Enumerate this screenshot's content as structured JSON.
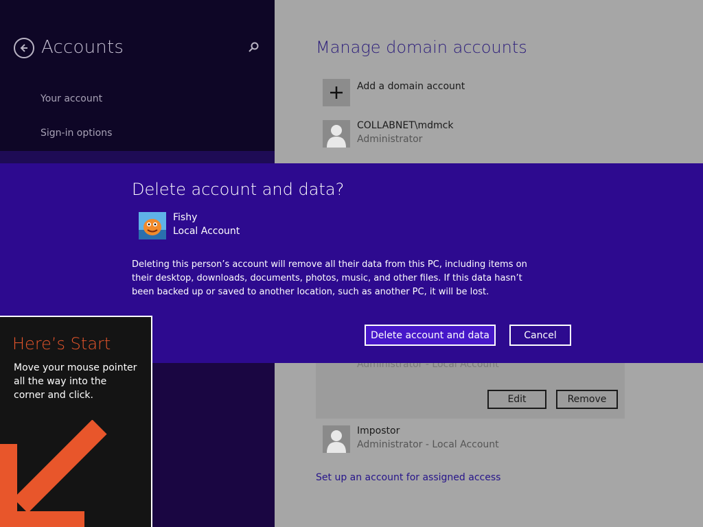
{
  "settings": {
    "title": "Accounts",
    "nav": [
      {
        "label": "Your account"
      },
      {
        "label": "Sign-in options"
      }
    ]
  },
  "content": {
    "heading": "Manage domain accounts",
    "add_label": "Add a domain account",
    "accounts": [
      {
        "name": "COLLABNET\\mdmck",
        "role": "Administrator"
      }
    ],
    "selected_card": {
      "role": "Administrator - Local Account",
      "edit_label": "Edit",
      "remove_label": "Remove"
    },
    "other_account": {
      "name": "Impostor",
      "role": "Administrator - Local Account"
    },
    "assigned_access_link": "Set up an account for assigned access"
  },
  "dialog": {
    "title": "Delete account and data?",
    "user_name": "Fishy",
    "account_type": "Local Account",
    "description": "Deleting this person’s account will remove all their data from this PC, including items on their desktop, downloads, documents, photos, music, and other files. If this data hasn’t been backed up or saved to another location, such as another PC, it will be lost.",
    "confirm_label": "Delete account and data",
    "cancel_label": "Cancel"
  },
  "start_tip": {
    "title": "Here’s Start",
    "body": "Move your mouse pointer all the way into the corner and click."
  },
  "colors": {
    "dialog_bg": "#2d0a8f",
    "primary_button": "#4617c9",
    "accent_orange": "#e8562b",
    "heading_blue": "#2c1d7a"
  }
}
